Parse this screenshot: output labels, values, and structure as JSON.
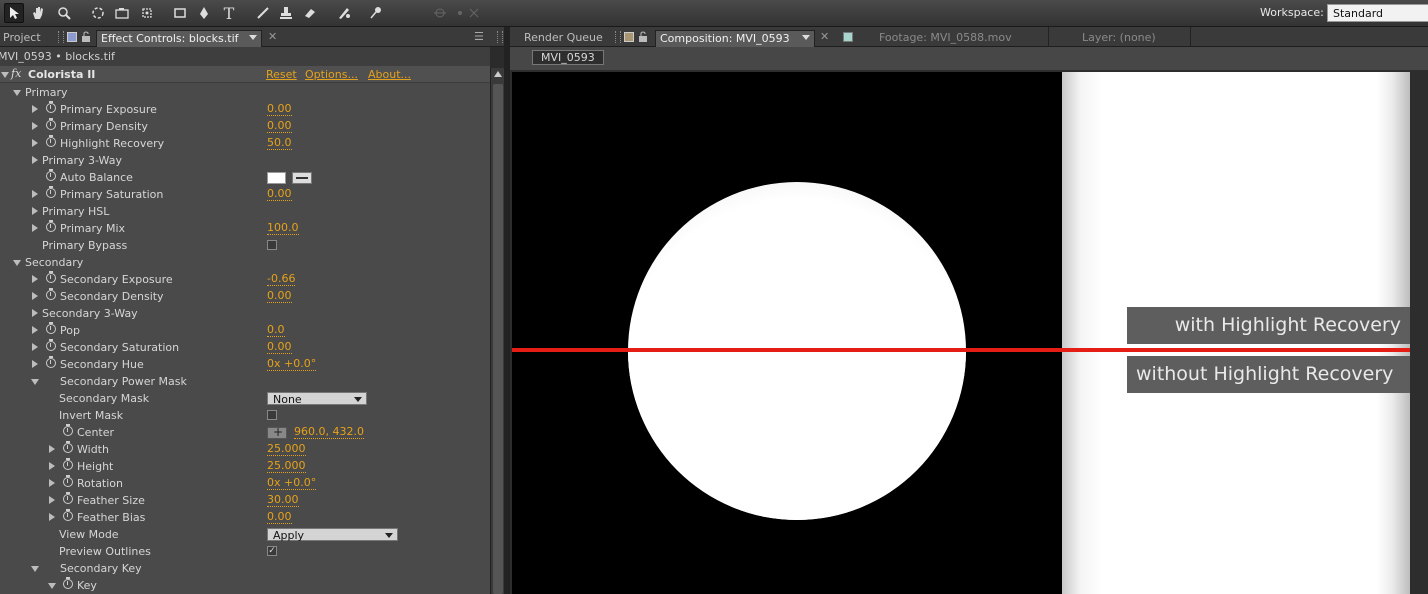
{
  "toolbar": {
    "tools": [
      "selection-tool",
      "hand-tool",
      "zoom-tool",
      "rotation-tool",
      "camera-tool",
      "pan-behind-tool",
      "rectangle-tool",
      "pen-tool",
      "text-tool",
      "brush-tool",
      "clone-stamp-tool",
      "eraser-tool",
      "roto-brush-tool",
      "puppet-pin-tool"
    ],
    "workspace_label": "Workspace:",
    "workspace_value": "Standard"
  },
  "left_panel": {
    "tabs": [
      {
        "label": "Project",
        "active": false
      },
      {
        "label": "Effect Controls: blocks.tif",
        "active": true
      }
    ],
    "subtitle": "MVI_0593 • blocks.tif",
    "effect": {
      "fx_symbol": "fx",
      "name": "Colorista II",
      "links": [
        "Reset",
        "Options...",
        "About..."
      ]
    },
    "rows": [
      {
        "label": "Primary",
        "indent": 1,
        "twirl": "down"
      },
      {
        "label": "Primary Exposure",
        "indent": 2,
        "twirl": "right",
        "stopwatch": true,
        "value": "0.00"
      },
      {
        "label": "Primary Density",
        "indent": 2,
        "twirl": "right",
        "stopwatch": true,
        "value": "0.00"
      },
      {
        "label": "Highlight Recovery",
        "indent": 2,
        "twirl": "right",
        "stopwatch": true,
        "value": "50.0"
      },
      {
        "label": "Primary 3-Way",
        "indent": 1.5,
        "twirl": "right"
      },
      {
        "label": "Auto Balance",
        "indent": 2,
        "stopwatch": true,
        "control": "color"
      },
      {
        "label": "Primary Saturation",
        "indent": 2,
        "twirl": "right",
        "stopwatch": true,
        "value": "0.00"
      },
      {
        "label": "Primary HSL",
        "indent": 1.5,
        "twirl": "right"
      },
      {
        "label": "Primary Mix",
        "indent": 2,
        "twirl": "right",
        "stopwatch": true,
        "value": "100.0"
      },
      {
        "label": "Primary Bypass",
        "indent": 1.5,
        "control": "checkbox",
        "checked": false
      },
      {
        "label": "Secondary",
        "indent": 1,
        "twirl": "down"
      },
      {
        "label": "Secondary Exposure",
        "indent": 2,
        "twirl": "right",
        "stopwatch": true,
        "value": "-0.66"
      },
      {
        "label": "Secondary Density",
        "indent": 2,
        "twirl": "right",
        "stopwatch": true,
        "value": "0.00"
      },
      {
        "label": "Secondary 3-Way",
        "indent": 1.5,
        "twirl": "right"
      },
      {
        "label": "Pop",
        "indent": 2,
        "twirl": "right",
        "stopwatch": true,
        "value": "0.0"
      },
      {
        "label": "Secondary Saturation",
        "indent": 2,
        "twirl": "right",
        "stopwatch": true,
        "value": "0.00"
      },
      {
        "label": "Secondary Hue",
        "indent": 2,
        "twirl": "right",
        "stopwatch": true,
        "value": "0x +0.0°"
      },
      {
        "label": "Secondary Power Mask",
        "indent": 2,
        "twirl": "down"
      },
      {
        "label": "Secondary Mask",
        "indent": 3,
        "control": "dropdown",
        "value": "None",
        "width": 100
      },
      {
        "label": "Invert Mask",
        "indent": 3,
        "control": "checkbox",
        "checked": false
      },
      {
        "label": "Center",
        "indent": 4,
        "stopwatch": true,
        "control": "point",
        "value": "960.0, 432.0"
      },
      {
        "label": "Width",
        "indent": 4,
        "twirl": "right",
        "stopwatch": true,
        "value": "25.000"
      },
      {
        "label": "Height",
        "indent": 4,
        "twirl": "right",
        "stopwatch": true,
        "value": "25.000"
      },
      {
        "label": "Rotation",
        "indent": 4,
        "twirl": "right",
        "stopwatch": true,
        "value": "0x +0.0°"
      },
      {
        "label": "Feather Size",
        "indent": 4,
        "twirl": "right",
        "stopwatch": true,
        "value": "30.00"
      },
      {
        "label": "Feather Bias",
        "indent": 4,
        "twirl": "right",
        "stopwatch": true,
        "value": "0.00"
      },
      {
        "label": "View Mode",
        "indent": 3,
        "control": "dropdown",
        "value": "Apply",
        "width": 131
      },
      {
        "label": "Preview Outlines",
        "indent": 3,
        "control": "checkbox",
        "checked": true
      },
      {
        "label": "Secondary Key",
        "indent": 2,
        "twirl": "down"
      },
      {
        "label": "Key",
        "indent": 4,
        "twirl": "down",
        "stopwatch": true
      }
    ]
  },
  "right_panel": {
    "tabs": [
      {
        "label": "Render Queue",
        "active": false
      },
      {
        "label": "Composition: MVI_0593",
        "active": true
      },
      {
        "label": "Footage: MVI_0588.mov",
        "active": false
      },
      {
        "label": "Layer: (none)",
        "active": false
      }
    ],
    "comp_button": "MVI_0593",
    "overlay_top": "with Highlight Recovery",
    "overlay_bottom": "without Highlight Recovery",
    "accent_line_color": "#e41e14"
  }
}
